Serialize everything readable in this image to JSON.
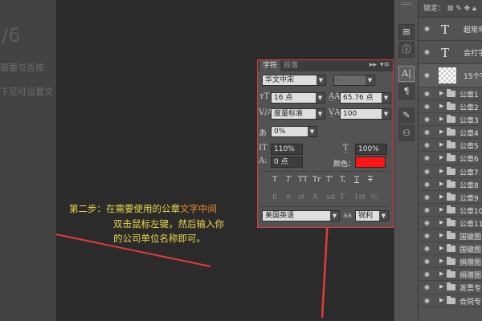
{
  "document": {
    "fragment_big": "/6",
    "fragment_line1": "需要与否按",
    "fragment_line2": "下足可设置文"
  },
  "annotation": {
    "prefix": "第二步：在需要使用的公章",
    "highlight": "文字中间",
    "line2": "双击鼠标左键，然后输入你",
    "line3": "的公司单位名称即可。",
    "arrow_color": "#e23a3a"
  },
  "character_panel": {
    "tabs": [
      "字符",
      "段落"
    ],
    "font_family": "华文中宋",
    "font_style": "-",
    "font_size": "16 点",
    "leading": "65.76 点",
    "kerning": "度量标准",
    "tracking": "100",
    "tsume": "0%",
    "vertical_scale": "110%",
    "horizontal_scale": "100%",
    "baseline_shift": "0 点",
    "color_label": "颜色：",
    "color": "#ff1414",
    "style_buttons": [
      "T",
      "T",
      "TT",
      "Tr",
      "T'",
      "T,",
      "T",
      "T"
    ],
    "opentype_buttons": [
      "fi",
      "σ",
      "st",
      "A",
      "ad",
      "T",
      "1st",
      "½"
    ],
    "language": "美国英语",
    "aa_icon": "aa",
    "antialias": "锐利",
    "border_color": "#e23a3a"
  },
  "layers_panel": {
    "lock_label": "锁定：",
    "text_layers": [
      {
        "name": "超常年"
      },
      {
        "name": "会打字"
      },
      {
        "name": "15个字"
      }
    ],
    "groups": [
      "公章1",
      "公章2",
      "公章3",
      "公章4",
      "公章5",
      "公章6",
      "公章7",
      "公章8",
      "公章9",
      "公章10",
      "公章11",
      "国徽图",
      "国徽图",
      "捐赠图",
      "捐赠图",
      "发票专",
      "合同专"
    ]
  }
}
